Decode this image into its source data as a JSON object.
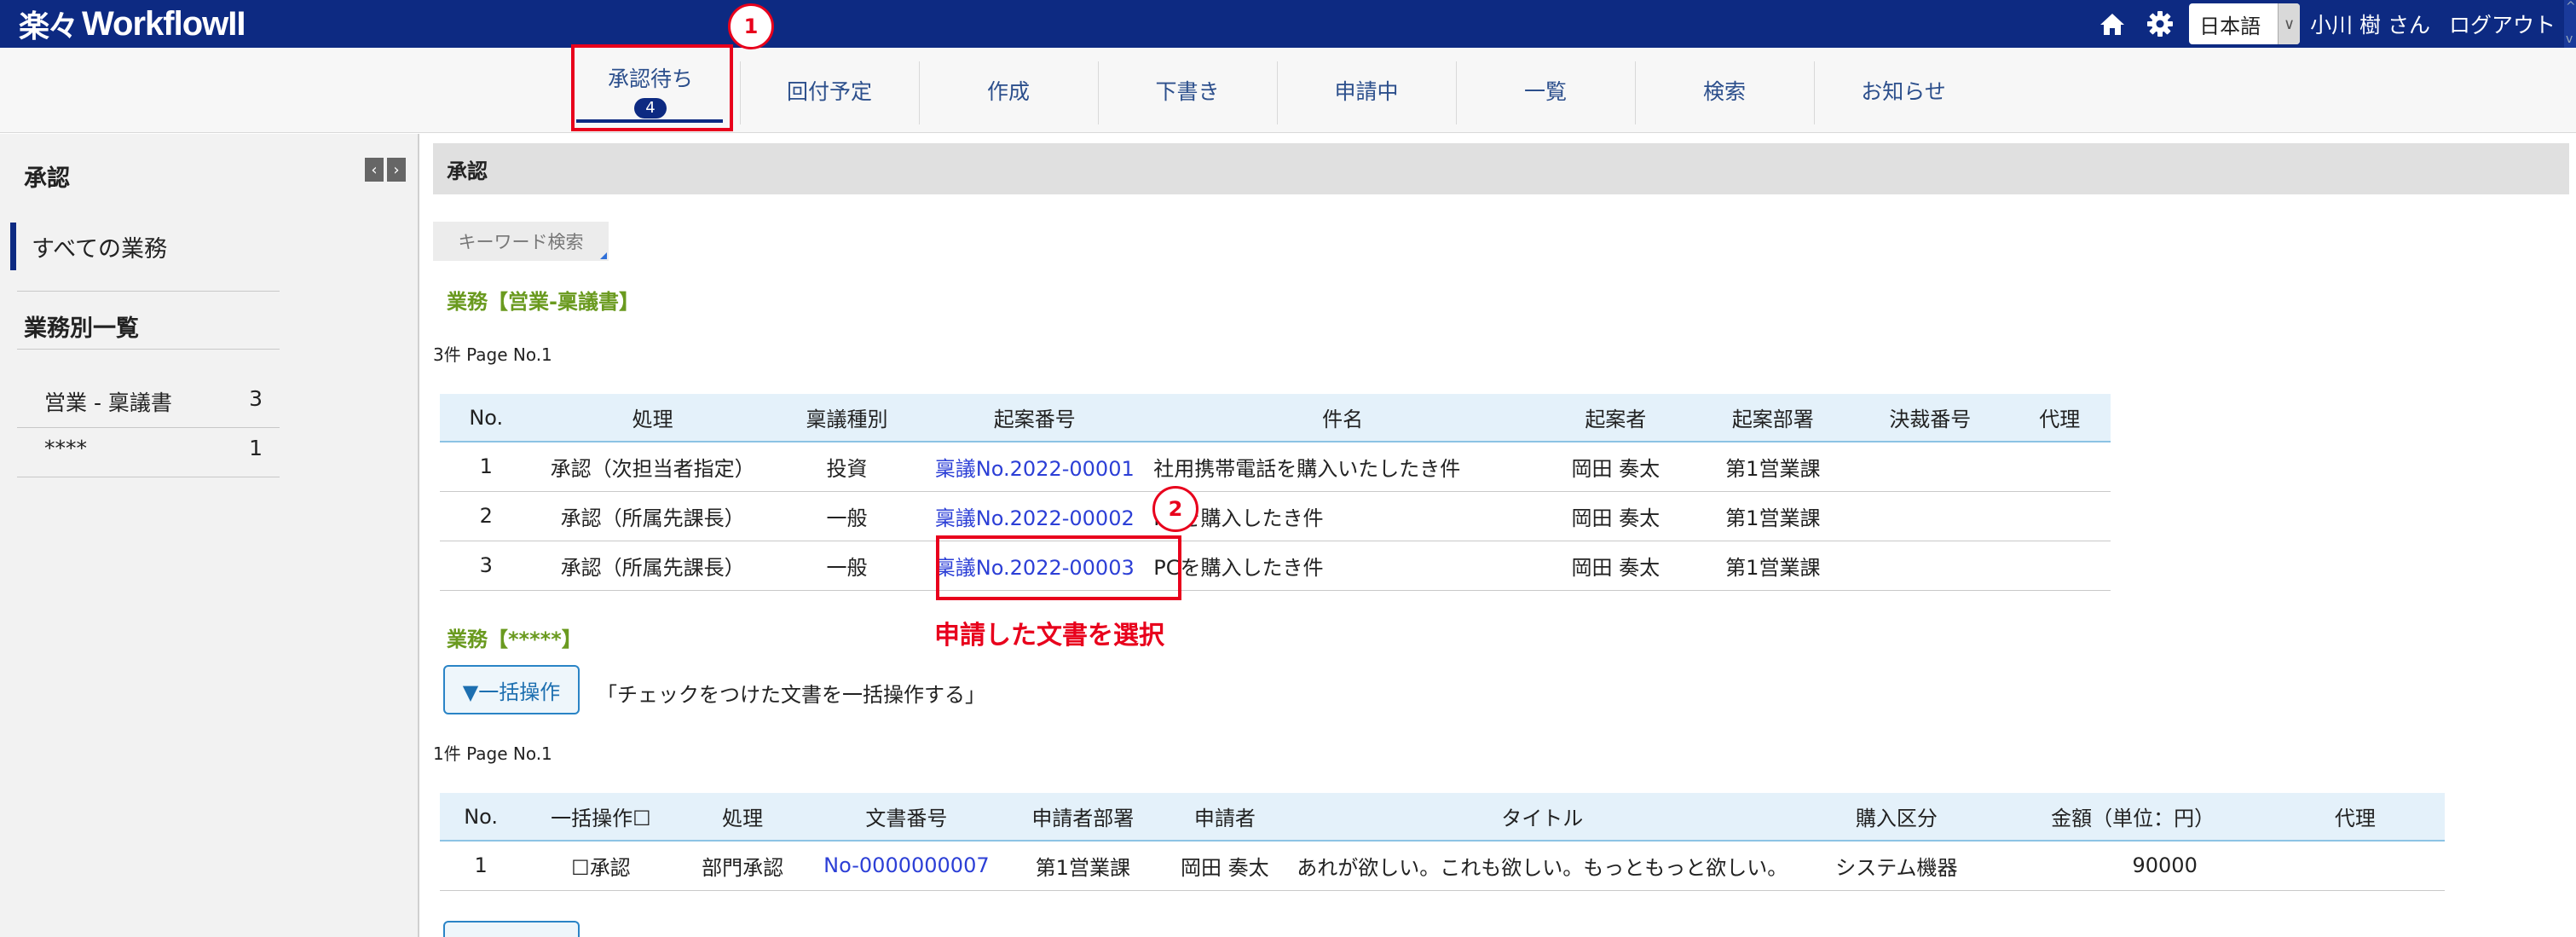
{
  "app": {
    "logo_mark": "楽々",
    "logo_text": "WorkflowII"
  },
  "topbar": {
    "home_icon": "home-icon",
    "settings_icon": "gear-icon",
    "language": "日本語",
    "user": "小川 樹 さん",
    "logout": "ログアウト"
  },
  "tabs": [
    {
      "label": "承認待ち",
      "badge": "4"
    },
    {
      "label": "回付予定"
    },
    {
      "label": "作成"
    },
    {
      "label": "下書き"
    },
    {
      "label": "申請中"
    },
    {
      "label": "一覧"
    },
    {
      "label": "検索"
    },
    {
      "label": "お知らせ"
    }
  ],
  "sidebar": {
    "title": "承認",
    "all_tasks": "すべての業務",
    "by_task_title": "業務別一覧",
    "items": [
      {
        "label": "営業 - 稟議書",
        "count": "3"
      },
      {
        "label": "****",
        "count": "1"
      }
    ]
  },
  "main": {
    "header": "承認",
    "keyword_search": "キーワード検索",
    "section1": {
      "title": "業務【営業-稟議書】",
      "page_info": "3件 Page No.1",
      "columns": [
        "No.",
        "処理",
        "稟議種別",
        "起案番号",
        "件名",
        "起案者",
        "起案部署",
        "決裁番号",
        "代理"
      ],
      "rows": [
        {
          "no": "1",
          "action": "承認（次担当者指定）",
          "type": "投資",
          "number": "稟議No.2022-00001",
          "subject": "社用携帯電話を購入いたしたき件",
          "drafter": "岡田 奏太",
          "dept": "第1営業課",
          "decision": "",
          "proxy": ""
        },
        {
          "no": "2",
          "action": "承認（所属先課長）",
          "type": "一般",
          "number": "稟議No.2022-00002",
          "subject": "PCを購入したき件",
          "drafter": "岡田 奏太",
          "dept": "第1営業課",
          "decision": "",
          "proxy": ""
        },
        {
          "no": "3",
          "action": "承認（所属先課長）",
          "type": "一般",
          "number": "稟議No.2022-00003",
          "subject": "PCを購入したき件",
          "drafter": "岡田 奏太",
          "dept": "第1営業課",
          "decision": "",
          "proxy": ""
        }
      ]
    },
    "section2": {
      "title": "業務【*****】",
      "bulk_button": "▼一括操作",
      "bulk_note": "「チェックをつけた文書を一括操作する」",
      "page_info": "1件 Page No.1",
      "columns": [
        "No.",
        "一括操作☐",
        "処理",
        "文書番号",
        "申請者部署",
        "申請者",
        "タイトル",
        "購入区分",
        "金額（単位：円）",
        "代理"
      ],
      "rows": [
        {
          "no": "1",
          "bulk": "☐承認",
          "action": "部門承認",
          "doc_no": "No-0000000007",
          "dept": "第1営業課",
          "applicant": "岡田 奏太",
          "title": "あれが欲しい。これも欲しい。もっともっと欲しい。",
          "category": "システム機器",
          "amount": "90000",
          "proxy": ""
        }
      ]
    }
  },
  "annotations": {
    "step1": "1",
    "step2": "2",
    "instruction": "申請した文書を選択"
  }
}
